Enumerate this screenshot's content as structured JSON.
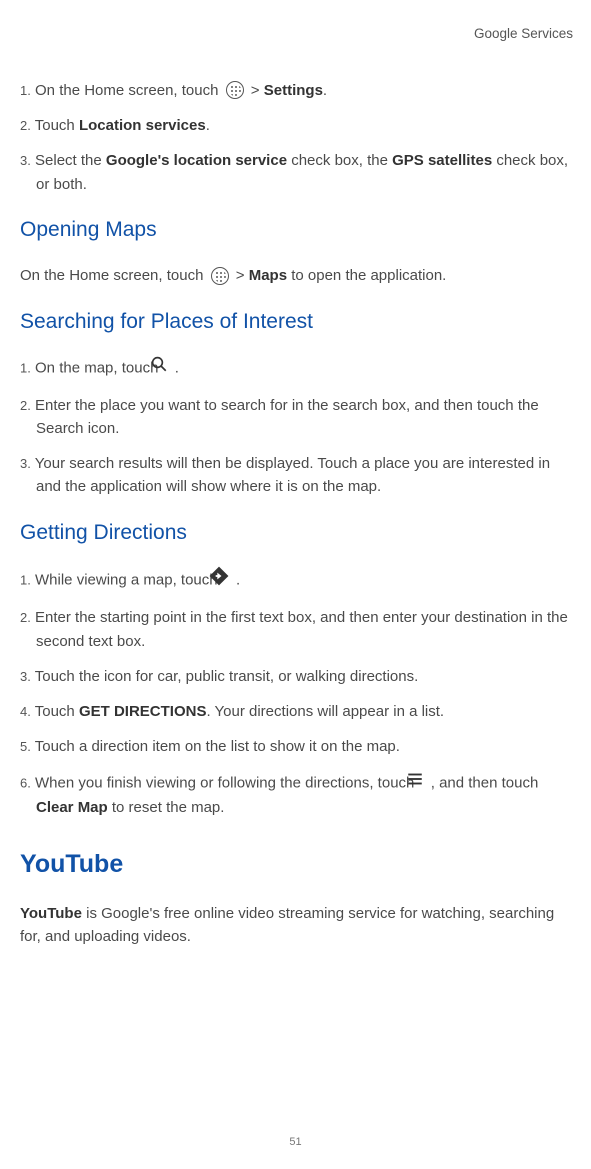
{
  "header": {
    "chapter": "Google Services"
  },
  "section1": {
    "steps": {
      "s1": {
        "num": "1.",
        "pre": "On the Home screen, touch ",
        "post1": " > ",
        "bold1": "Settings",
        "post2": "."
      },
      "s2": {
        "num": "2.",
        "pre": "Touch ",
        "bold1": "Location services",
        "post1": "."
      },
      "s3": {
        "num": "3.",
        "pre": "Select the ",
        "bold1": "Google's location service",
        "mid": " check box, the ",
        "bold2": "GPS satellites",
        "post": " check box, or both."
      }
    }
  },
  "openingMaps": {
    "heading": "Opening Maps",
    "para": {
      "pre": "On the Home screen, touch ",
      "post1": " > ",
      "bold1": "Maps",
      "post2": " to open the application."
    }
  },
  "searching": {
    "heading": "Searching for Places of Interest",
    "steps": {
      "s1": {
        "num": "1.",
        "pre": "On the map, touch ",
        "post": " ."
      },
      "s2": {
        "num": "2.",
        "text": "Enter the place you want to search for in the search box, and then touch the Search icon."
      },
      "s3": {
        "num": "3.",
        "text": "Your search results will then be displayed. Touch a place you are interested in and the application will show where it is on the map."
      }
    }
  },
  "directions": {
    "heading": "Getting Directions",
    "steps": {
      "s1": {
        "num": "1.",
        "pre": "While viewing a map, touch ",
        "post": "."
      },
      "s2": {
        "num": "2.",
        "text": "Enter the starting point in the first text box, and then enter your destination in the second text box."
      },
      "s3": {
        "num": "3.",
        "text": "Touch the icon for car, public transit, or walking directions."
      },
      "s4": {
        "num": "4.",
        "pre": "Touch ",
        "bold1": "GET DIRECTIONS",
        "post": ". Your directions will appear in a list."
      },
      "s5": {
        "num": "5.",
        "text": "Touch a direction item on the list to show it on the map."
      },
      "s6": {
        "num": "6.",
        "pre": "When you finish viewing or following the directions, touch ",
        "mid": " , and then touch ",
        "bold1": "Clear Map",
        "post": " to reset the map."
      }
    }
  },
  "youtube": {
    "heading": "YouTube",
    "para": {
      "bold1": "YouTube",
      "post": " is Google's free online video streaming service for watching, searching for, and uploading videos."
    }
  },
  "pageNumber": "51"
}
